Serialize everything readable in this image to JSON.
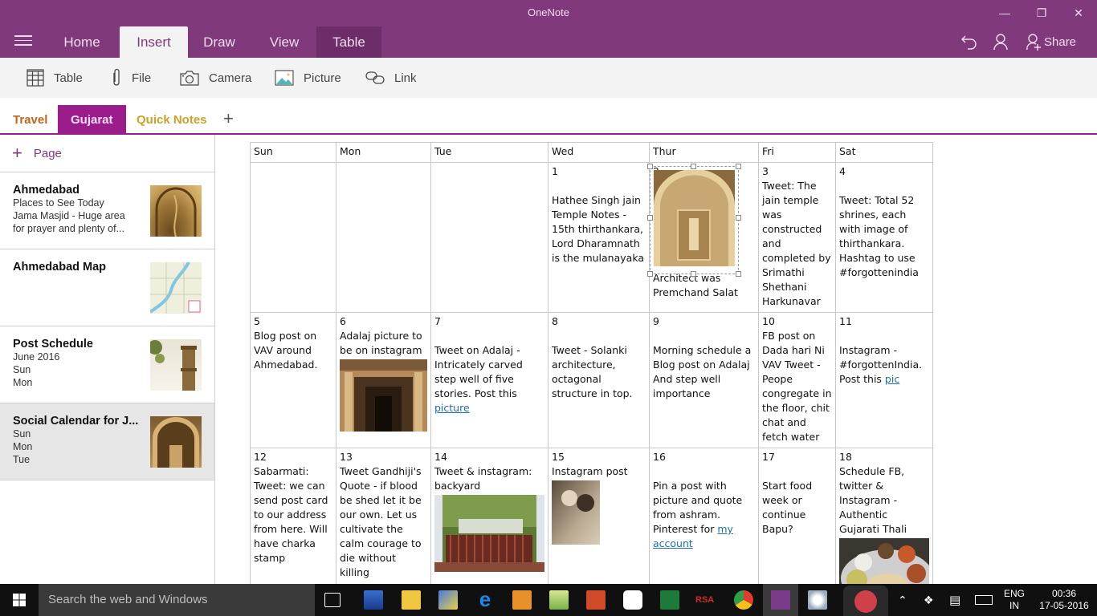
{
  "window": {
    "title": "OneNote",
    "controls": {
      "minimize": "—",
      "restore": "❐",
      "close": "✕"
    }
  },
  "ribbon": {
    "menu_icon": "hamburger-icon",
    "tabs": [
      {
        "label": "Home",
        "state": "normal"
      },
      {
        "label": "Insert",
        "state": "active"
      },
      {
        "label": "Draw",
        "state": "normal"
      },
      {
        "label": "View",
        "state": "normal"
      },
      {
        "label": "Table",
        "state": "contextual"
      }
    ],
    "right": {
      "undo_icon": "undo-icon",
      "account_icon": "person-icon",
      "share_label": "Share"
    }
  },
  "toolbar": {
    "items": [
      {
        "label": "Table",
        "icon": "table-icon"
      },
      {
        "label": "File",
        "icon": "paperclip-icon"
      },
      {
        "label": "Camera",
        "icon": "camera-icon"
      },
      {
        "label": "Picture",
        "icon": "picture-icon"
      },
      {
        "label": "Link",
        "icon": "link-icon"
      }
    ]
  },
  "sections": {
    "tabs": [
      {
        "label": "Travel",
        "color": "#c0641b",
        "active": false
      },
      {
        "label": "Gujarat",
        "color": "#9b1d8c",
        "active": true
      },
      {
        "label": "Quick Notes",
        "color": "#c9a227",
        "active": false
      }
    ],
    "add_label": "+"
  },
  "pages": {
    "add_label": "Page",
    "items": [
      {
        "title": "Ahmedabad",
        "lines": [
          "Places to See Today",
          "Jama Masjid - Huge area",
          "for prayer and plenty of..."
        ],
        "selected": false,
        "thumb": "carved-window"
      },
      {
        "title": "Ahmedabad Map",
        "lines": [],
        "selected": false,
        "thumb": "map"
      },
      {
        "title": "Post Schedule",
        "lines": [
          "June 2016",
          "Sun",
          "Mon"
        ],
        "selected": false,
        "thumb": "tower"
      },
      {
        "title": "Social Calendar for J...",
        "lines": [
          "Sun",
          "Mon",
          "Tue"
        ],
        "selected": true,
        "thumb": "arch"
      }
    ]
  },
  "calendar": {
    "headers": [
      "Sun",
      "Mon",
      "Tue",
      "Wed",
      "Thur",
      "Fri",
      "Sat"
    ],
    "weeks": [
      [
        {
          "day": "",
          "text": ""
        },
        {
          "day": "",
          "text": ""
        },
        {
          "day": "",
          "text": ""
        },
        {
          "day": "1",
          "text": "Hathee Singh jain Temple Notes - 15th thirthankara, Lord Dharamnath is the mulanayaka"
        },
        {
          "day": "2",
          "text": "Architect was Premchand Salat",
          "image": "temple-arch"
        },
        {
          "day": "3",
          "text": "Tweet: The jain temple was constructed and completed by Srimathi Shethani Harkunavar"
        },
        {
          "day": "4",
          "text": "Tweet: Total 52 shrines, each with image of thirthankara. Hashtag to use #forgottenindia"
        }
      ],
      [
        {
          "day": "5",
          "text": "Blog post on VAV around Ahmedabad."
        },
        {
          "day": "6",
          "text": "Adalaj picture to be on instagram",
          "image": "stepwell"
        },
        {
          "day": "7",
          "text": "Tweet on Adalaj - Intricately carved step well of five stories. Post this",
          "link": "picture"
        },
        {
          "day": "8",
          "text": "Tweet - Solanki architecture, octagonal structure in top."
        },
        {
          "day": "9",
          "text": "Morning schedule a Blog post on Adalaj And step well importance"
        },
        {
          "day": "10",
          "text": "FB post on Dada hari Ni VAV Tweet - Peope congregate in the floor, chit chat and fetch water"
        },
        {
          "day": "11",
          "text": "Instagram - #forgottenIndia. Post this",
          "link": "pic"
        }
      ],
      [
        {
          "day": "12",
          "text": "Sabarmati: Tweet: we can send post card to our address from here. Will have charka stamp"
        },
        {
          "day": "13",
          "text": "Tweet Gandhiji's Quote - if blood be shed let it be our own. Let us cultivate the calm courage to die without killing"
        },
        {
          "day": "14",
          "text": "Tweet & instagram: backyard",
          "image": "garden-gate"
        },
        {
          "day": "15",
          "text": "Instagram post",
          "image": "gandhi-photo"
        },
        {
          "day": "16",
          "text": "Pin a post with picture and quote from ashram. Pinterest for",
          "link": "my account"
        },
        {
          "day": "17",
          "text": "Start food week or continue Bapu?"
        },
        {
          "day": "18",
          "text": "Schedule FB, twitter & Instagram - Authentic Gujarati Thali",
          "image": "thali"
        }
      ]
    ]
  },
  "taskbar": {
    "search_placeholder": "Search the web and Windows",
    "apps": [
      "task-view",
      "remote-desktop",
      "file-explorer",
      "network",
      "edge",
      "media-player",
      "notepad",
      "powerpoint",
      "airtel",
      "excel",
      "rsa",
      "chrome",
      "onenote",
      "paint"
    ],
    "tray": {
      "language": "ENG",
      "region": "IN",
      "time": "00:36",
      "date": "17-05-2016"
    }
  }
}
